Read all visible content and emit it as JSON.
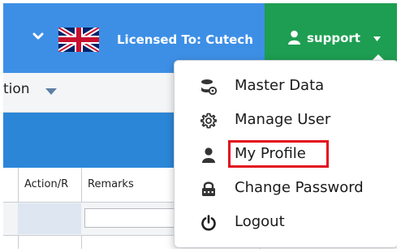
{
  "topbar": {
    "language": "English (UK)",
    "licensed_text": "Licensed To: Cutech",
    "user_label": "support"
  },
  "subbar": {
    "label": "tion"
  },
  "table": {
    "columns": [
      "Action/R",
      "Remarks"
    ],
    "filter_value": ""
  },
  "menu": {
    "items": [
      {
        "label": "Master Data",
        "icon": "database-settings-icon"
      },
      {
        "label": "Manage User",
        "icon": "gear-icon"
      },
      {
        "label": "My Profile",
        "icon": "user-icon",
        "highlighted": true
      },
      {
        "label": "Change Password",
        "icon": "lock-icon"
      },
      {
        "label": "Logout",
        "icon": "power-icon"
      }
    ]
  },
  "colors": {
    "topbar_blue": "#3d8fe6",
    "support_green": "#1e9e52",
    "band_blue": "#2b86d8",
    "highlight_red": "#e3101e"
  }
}
